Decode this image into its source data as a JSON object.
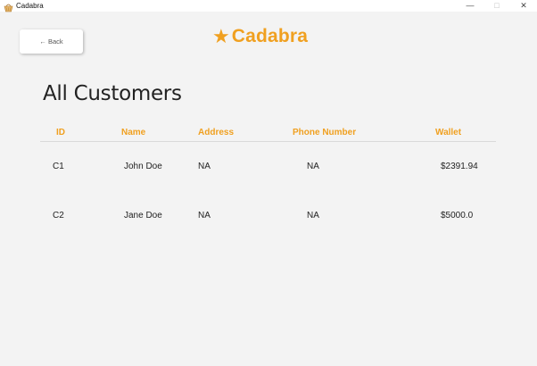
{
  "window": {
    "title": "Cadabra",
    "controls": {
      "minimize": "—",
      "maximize": "□",
      "close": "✕"
    }
  },
  "toolbar": {
    "back_label": "← Back"
  },
  "logo": {
    "star": "★",
    "text": "Cadabra",
    "color": "#f0a020"
  },
  "page": {
    "title": "All Customers"
  },
  "table": {
    "columns": [
      "ID",
      "Name",
      "Address",
      "Phone Number",
      "Wallet"
    ],
    "rows": [
      [
        "C1",
        "John Doe",
        "NA",
        "NA",
        "$2391.94"
      ],
      [
        "C2",
        "Jane Doe",
        "NA",
        "NA",
        "$5000.0"
      ]
    ]
  },
  "colors": {
    "accent": "#f0a020",
    "background": "#f3f3f3"
  }
}
